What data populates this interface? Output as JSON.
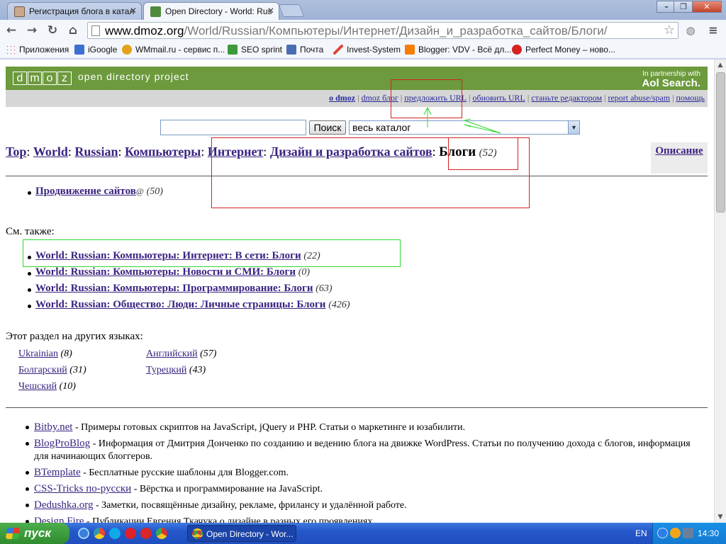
{
  "browser": {
    "tabs": [
      {
        "title": "Регистрация блога в катал",
        "active": false
      },
      {
        "title": "Open Directory - World: Rus",
        "active": true
      }
    ],
    "url_host": "www.dmoz.org",
    "url_path": "/World/Russian/Компьютеры/Интернет/Дизайн_и_разработка_сайтов/Блоги/",
    "bookmarks": [
      "Приложения",
      "iGoogle",
      "WMmail.ru - сервис п...",
      "SEO sprint",
      "Почта",
      "Invest-System",
      "Blogger: VDV - Всё дл...",
      "Perfect Money – ново..."
    ]
  },
  "dmoz": {
    "logo_letters": [
      "d",
      "m",
      "o",
      "z"
    ],
    "logo_text": "open directory project",
    "partner_small": "In partnership with",
    "partner_big": "Aol Search.",
    "nav": [
      "o dmoz",
      "dmoz блог",
      "предложить URL",
      "обновить URL",
      "станьте редактором",
      "report abuse/spam",
      "помощь"
    ],
    "search_button": "Поиск",
    "search_scope": "весь каталог",
    "breadcrumb": [
      "Top",
      "World",
      "Russian",
      "Компьютеры",
      "Интернет",
      "Дизайн и разработка сайтов"
    ],
    "current": "Блоги",
    "current_count": "(52)",
    "description_link": "Описание",
    "subcategories": [
      {
        "label": "Продвижение сайтов",
        "suffix": "@",
        "count": "(50)"
      }
    ],
    "see_also_label": "См. также:",
    "see_also": [
      {
        "label": "World: Russian: Компьютеры: Интернет: В сети: Блоги",
        "count": "(22)"
      },
      {
        "label": "World: Russian: Компьютеры: Новости и СМИ: Блоги",
        "count": "(0)"
      },
      {
        "label": "World: Russian: Компьютеры: Программирование: Блоги",
        "count": "(63)"
      },
      {
        "label": "World: Russian: Общество: Люди: Личные страницы: Блоги",
        "count": "(426)"
      }
    ],
    "languages_label": "Этот раздел на других языках:",
    "languages": [
      {
        "label": "Ukrainian",
        "count": "(8)"
      },
      {
        "label": "Болгарский",
        "count": "(31)"
      },
      {
        "label": "Чешский",
        "count": "(10)"
      },
      {
        "label": "Английский",
        "count": "(57)"
      },
      {
        "label": "Турецкий",
        "count": "(43)"
      }
    ],
    "sites": [
      {
        "title": "Bitby.net",
        "desc": " - Примеры готовых скриптов на JavaScript, jQuery и PHP. Статьи о маркетинге и юзабилити."
      },
      {
        "title": "BlogProBlog",
        "desc": " - Информация от Дмитрия Донченко по созданию и ведению блога на движке WordPress. Статьи по получению дохода с блогов, информация для начинающих блоггеров."
      },
      {
        "title": "BTemplate",
        "desc": " - Бесплатные русские шаблоны для Blogger.com."
      },
      {
        "title": "CSS-Tricks по-русски",
        "desc": " - Вёрстка и программирование на JavaScript."
      },
      {
        "title": "Dedushka.org",
        "desc": " - Заметки, посвящённые дизайну, рекламе, фрилансу и удалённой работе."
      },
      {
        "title": "Design Fire",
        "desc": " - Публикации Евгения Ткачука о дизайне в разных его проявлениях."
      }
    ]
  },
  "taskbar": {
    "start": "пуск",
    "task": "Open Directory - Wor...",
    "lang": "EN",
    "clock": "14:30"
  },
  "colors": {
    "dmoz_green": "#6c9a3c",
    "link": "#3a2380",
    "annotation_red": "#d42222",
    "annotation_green": "#2fd62f"
  }
}
